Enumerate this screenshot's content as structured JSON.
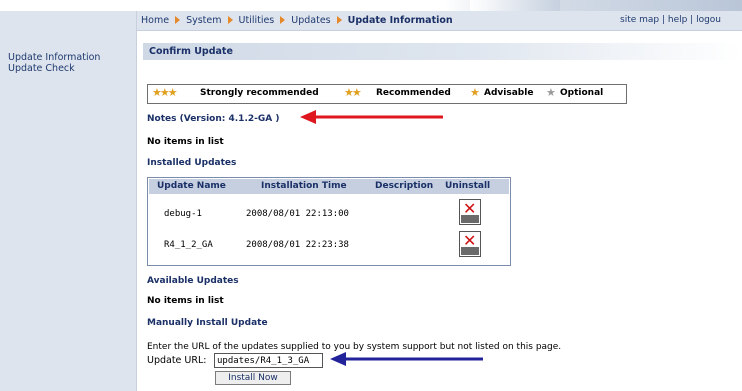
{
  "breadcrumb": {
    "items": [
      "Home",
      "System",
      "Utilities",
      "Updates"
    ],
    "current": "Update Information"
  },
  "top_links": "site map | help | logou",
  "sidebar": {
    "items": [
      {
        "label": "Update Information"
      },
      {
        "label": "Update Check"
      }
    ]
  },
  "section": {
    "title": "Confirm Update"
  },
  "legend": {
    "strongly": "Strongly recommended",
    "recommended": "Recommended",
    "advisable": "Advisable",
    "optional": "Optional"
  },
  "notes": {
    "title": "Notes (Version: 4.1.2-GA )",
    "empty": "No items in list"
  },
  "installed": {
    "title": "Installed Updates",
    "columns": [
      "Update Name",
      "Installation Time",
      "Description",
      "Uninstall"
    ],
    "rows": [
      {
        "name": "debug-1",
        "time": "2008/08/01 22:13:00",
        "description": ""
      },
      {
        "name": "R4_1_2_GA",
        "time": "2008/08/01 22:23:38",
        "description": ""
      }
    ]
  },
  "available": {
    "title": "Available Updates",
    "empty": "No items in list"
  },
  "manual": {
    "title": "Manually Install Update",
    "description": "Enter the URL of the updates supplied to you by system support but not listed on this page.",
    "url_label": "Update URL:",
    "url_value": "updates/R4_1_3_GA",
    "install_button": "Install Now"
  },
  "colors": {
    "arrow_red": "#e0161e",
    "arrow_blue": "#22239a",
    "header_blue": "#1a3067",
    "star_gold": "#e0a020"
  }
}
